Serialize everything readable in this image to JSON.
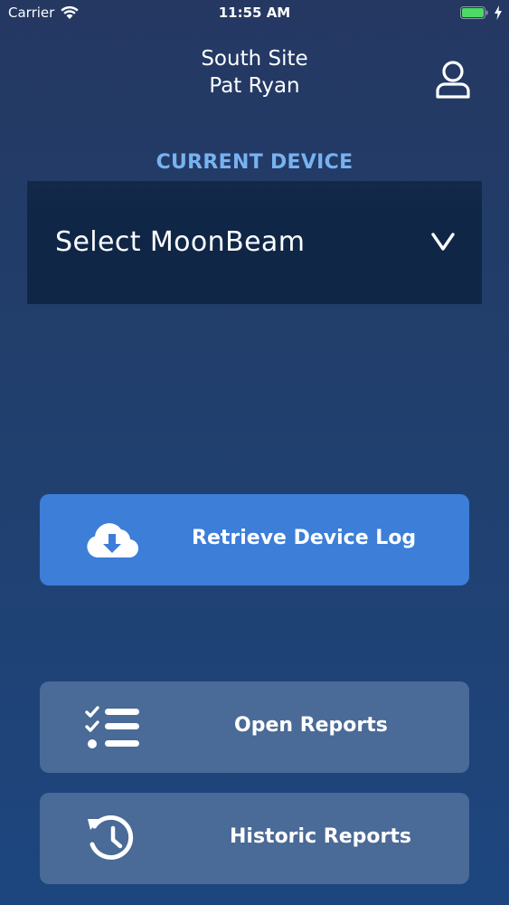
{
  "status_bar": {
    "carrier": "Carrier",
    "time": "11:55 AM",
    "battery_color": "#4cd964"
  },
  "header": {
    "site": "South Site",
    "user": "Pat Ryan",
    "profile_icon": "user-icon"
  },
  "device": {
    "label": "CURRENT DEVICE",
    "select_placeholder": "Select MoonBeam",
    "chevron_icon": "chevron-down-icon"
  },
  "actions": {
    "retrieve_log": {
      "label": "Retrieve Device Log",
      "icon": "cloud-download-icon"
    },
    "open_reports": {
      "label": "Open Reports",
      "icon": "checklist-icon"
    },
    "historic_reports": {
      "label": "Historic Reports",
      "icon": "history-icon"
    }
  },
  "colors": {
    "accent": "#3c7ed8",
    "label_blue": "#78b2f0",
    "secondary_button": "#4a6a97",
    "select_bg": "#0f2647"
  }
}
